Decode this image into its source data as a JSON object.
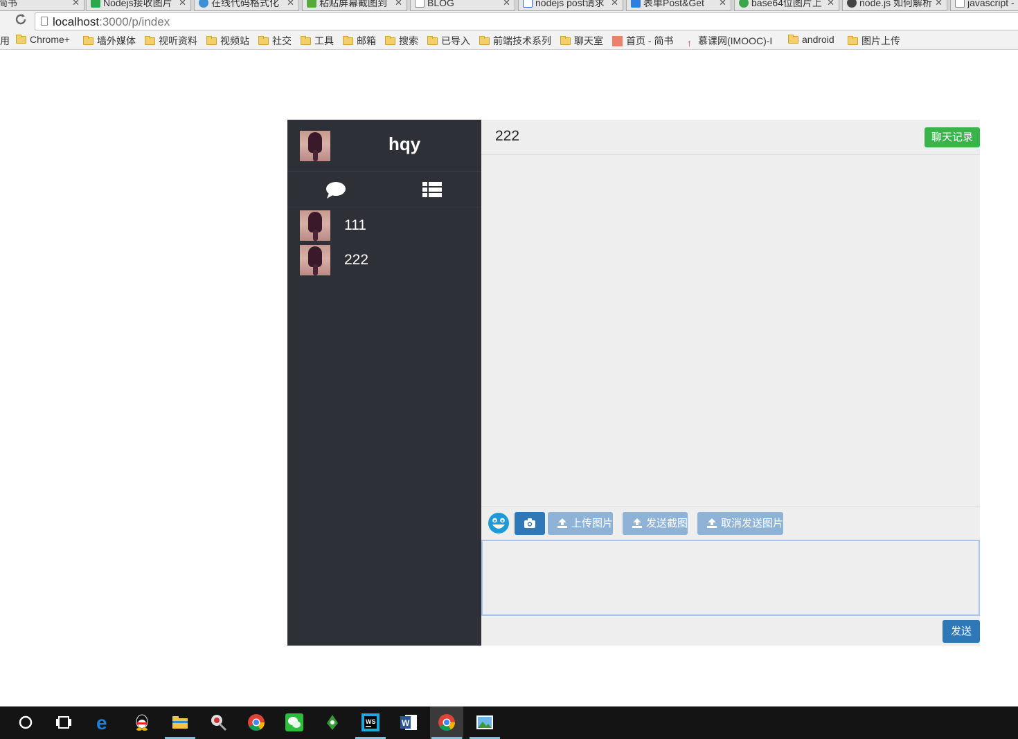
{
  "browser": {
    "tabs": [
      {
        "title": "简书",
        "icon": "page-icon"
      },
      {
        "title": "Nodejs接收图片",
        "icon": "sf-icon"
      },
      {
        "title": "在线代码格式化",
        "icon": "c-icon"
      },
      {
        "title": "粘贴屏幕截图到",
        "icon": "h-icon"
      },
      {
        "title": "BLOG",
        "icon": "page-icon"
      },
      {
        "title": "nodejs post请求",
        "icon": "page-icon"
      },
      {
        "title": "表单Post&Get",
        "icon": "m-icon"
      },
      {
        "title": "base64位图片上",
        "icon": "c-icon"
      },
      {
        "title": "node.js 如何解析",
        "icon": "c-icon"
      },
      {
        "title": "javascript -",
        "icon": "page-icon"
      }
    ],
    "url_host": "localhost",
    "url_path": ":3000/p/index",
    "bookmarks": [
      {
        "label": "用",
        "icon": "none"
      },
      {
        "label": "Chrome+",
        "icon": "folder-icon"
      },
      {
        "label": "墙外媒体",
        "icon": "folder-icon"
      },
      {
        "label": "视听资料",
        "icon": "folder-icon"
      },
      {
        "label": "视频站",
        "icon": "folder-icon"
      },
      {
        "label": "社交",
        "icon": "folder-icon"
      },
      {
        "label": "工具",
        "icon": "folder-icon"
      },
      {
        "label": "邮箱",
        "icon": "folder-icon"
      },
      {
        "label": "搜索",
        "icon": "folder-icon"
      },
      {
        "label": "已导入",
        "icon": "folder-icon"
      },
      {
        "label": "前端技术系列",
        "icon": "folder-icon"
      },
      {
        "label": "聊天室",
        "icon": "folder-icon"
      },
      {
        "label": "首页 - 简书",
        "icon": "jianshu-icon"
      },
      {
        "label": "慕课网(IMOOC)-I",
        "icon": "imooc-icon"
      },
      {
        "label": "android",
        "icon": "folder-icon"
      },
      {
        "label": "图片上传",
        "icon": "folder-icon"
      }
    ]
  },
  "chat": {
    "user": {
      "name": "hqy"
    },
    "contacts": [
      {
        "name": "111"
      },
      {
        "name": "222"
      }
    ],
    "current_contact": "222",
    "history_label": "聊天记录",
    "toolbar": {
      "upload_image": "上传图片",
      "send_screenshot": "发送截图",
      "cancel_send_image": "取消发送图片"
    },
    "input_value": "",
    "send_label": "发送",
    "colors": {
      "sidebar": "#2e3038",
      "main": "#eeeeee",
      "history_button": "#3ab34a",
      "primary_button": "#2e78b8",
      "light_button": "#8fb3d6"
    }
  },
  "taskbar": {
    "items": [
      "cortana-icon",
      "task-view-icon",
      "edge-icon",
      "qq-icon",
      "file-explorer-icon",
      "tool-icon",
      "chrome-icon",
      "wechat-icon",
      "app-icon",
      "webstorm-icon",
      "word-icon",
      "chrome-active-icon",
      "photos-icon"
    ]
  }
}
